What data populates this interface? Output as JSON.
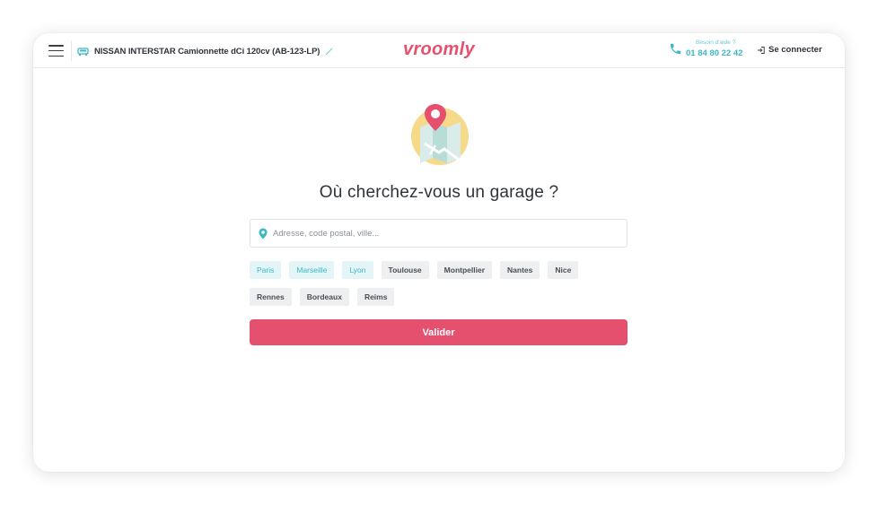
{
  "header": {
    "vehicle_label": "NISSAN INTERSTAR Camionnette dCi 120cv (AB-123-LP)",
    "logo": "vroomly",
    "help_label": "Besoin d'aide ?",
    "help_phone": "01 84 80 22 42",
    "connect_label": "Se connecter"
  },
  "main": {
    "title": "Où cherchez-vous un garage ?",
    "search_placeholder": "Adresse, code postal, ville...",
    "cities_row1": [
      "Paris",
      "Marseille",
      "Lyon",
      "Toulouse",
      "Montpellier",
      "Nantes",
      "Nice"
    ],
    "cities_row2": [
      "Rennes",
      "Bordeaux",
      "Reims"
    ],
    "submit_label": "Valider"
  },
  "colors": {
    "brand": "#e5506e",
    "accent_teal": "#3fb7c4"
  },
  "icons": [
    "menu-icon",
    "car-icon",
    "edit-pencil-icon",
    "phone-icon",
    "login-icon",
    "map-pin-icon",
    "map-illustration"
  ]
}
